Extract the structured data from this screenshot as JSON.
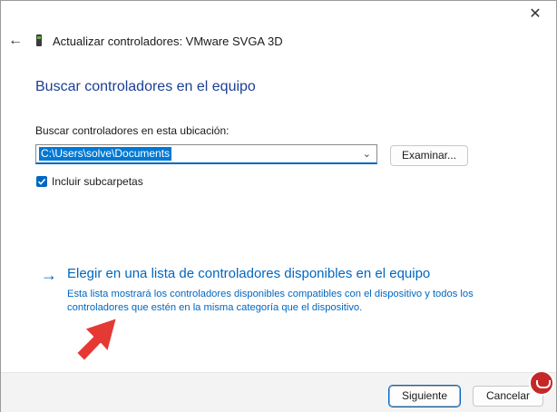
{
  "window": {
    "title": "Actualizar controladores: VMware SVGA 3D",
    "close_icon": "close-icon",
    "back_icon": "back-arrow-icon",
    "device_icon": "display-adapter-icon"
  },
  "main": {
    "heading": "Buscar controladores en el equipo",
    "location_label": "Buscar controladores en esta ubicación:",
    "path_value": "C:\\Users\\solve\\Documents",
    "browse_label": "Examinar...",
    "include_subfolders_label": "Incluir subcarpetas",
    "include_subfolders_checked": true,
    "choose_link_title": "Elegir en una lista de controladores disponibles en el equipo",
    "choose_link_desc": "Esta lista mostrará los controladores disponibles compatibles con el dispositivo y todos los controladores que estén en la misma categoría que el dispositivo."
  },
  "footer": {
    "next_label": "Siguiente",
    "cancel_label": "Cancelar"
  },
  "colors": {
    "accent": "#0067c0",
    "heading": "#1c3f94",
    "pointer_arrow": "#e53935"
  }
}
